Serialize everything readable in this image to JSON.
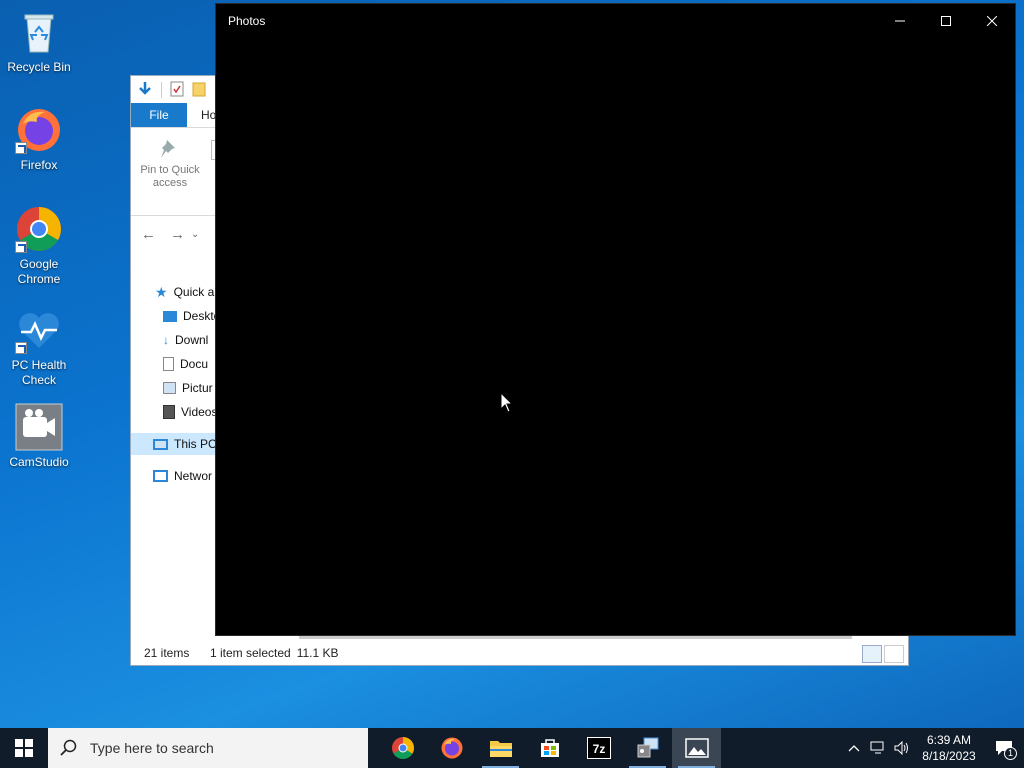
{
  "desktop": {
    "icons": [
      {
        "label": "Recycle Bin"
      },
      {
        "label": "Firefox"
      },
      {
        "label": "Google Chrome"
      },
      {
        "label": "PC Health Check"
      },
      {
        "label": "CamStudio"
      }
    ]
  },
  "explorer": {
    "tab_file": "File",
    "tab_home": "Ho",
    "pin_label": "Pin to Quick access",
    "nav": {
      "quick_access": "Quick a",
      "desktop": "Deskto",
      "downloads": "Downl",
      "documents": "Docu",
      "pictures": "Pictur",
      "videos": "Videos",
      "this_pc": "This PC",
      "network": "Networ"
    },
    "status": {
      "items": "21 items",
      "selected": "1 item selected",
      "size": "11.1 KB"
    }
  },
  "photos": {
    "title": "Photos"
  },
  "taskbar": {
    "search_placeholder": "Type here to search",
    "apps": [
      "chrome-icon",
      "firefox-icon",
      "file-explorer-icon",
      "store-icon",
      "7zip-icon",
      "app-icon",
      "photos-icon"
    ],
    "time": "6:39 AM",
    "date": "8/18/2023",
    "notification_count": "1"
  },
  "colors": {
    "accent": "#1979ca",
    "taskbar": "#101c2a",
    "photos_bg": "#000000"
  }
}
